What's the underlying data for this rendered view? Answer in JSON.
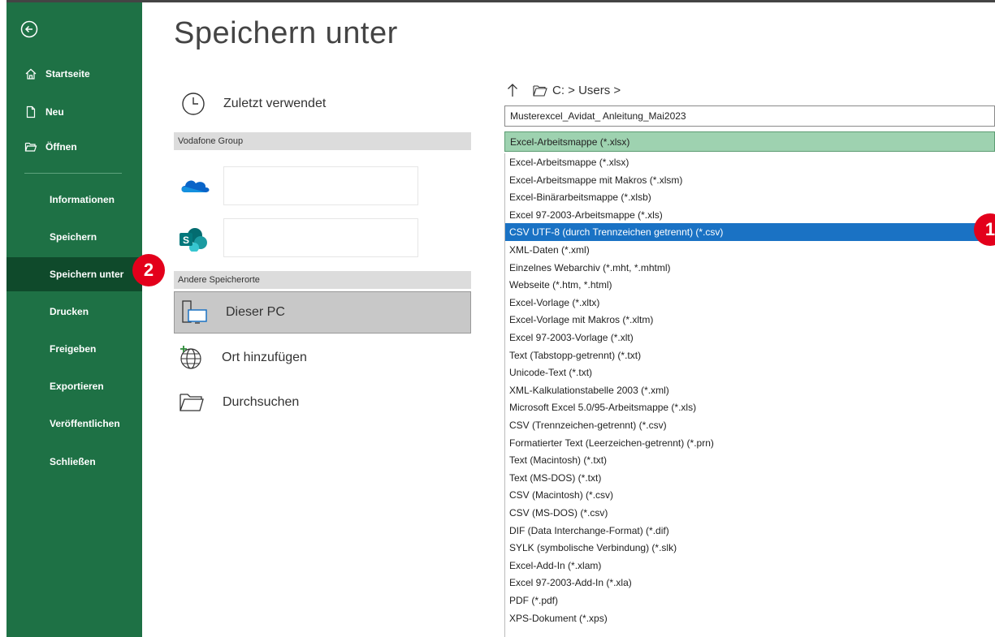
{
  "title": "Speichern unter",
  "sidebar": {
    "top_items": [
      {
        "label": "Startseite",
        "icon": "home-icon"
      },
      {
        "label": "Neu",
        "icon": "new-document-icon"
      },
      {
        "label": "Öffnen",
        "icon": "open-folder-icon"
      }
    ],
    "items": [
      {
        "label": "Informationen"
      },
      {
        "label": "Speichern"
      },
      {
        "label": "Speichern unter",
        "active": true
      },
      {
        "label": "Drucken"
      },
      {
        "label": "Freigeben"
      },
      {
        "label": "Exportieren"
      },
      {
        "label": "Veröffentlichen"
      },
      {
        "label": "Schließen"
      }
    ]
  },
  "badges": {
    "save_as": "2",
    "csv": "1"
  },
  "locations": {
    "recent": "Zuletzt verwendet",
    "group_header": "Vodafone Group",
    "other_header": "Andere Speicherorte",
    "this_pc": "Dieser PC",
    "add_place": "Ort hinzufügen",
    "browse": "Durchsuchen"
  },
  "path": "C: > Users >",
  "filename": "Musterexcel_Avidat_ Anleitung_Mai2023",
  "selected_type": "Excel-Arbeitsmappe (*.xlsx)",
  "file_types": [
    "Excel-Arbeitsmappe (*.xlsx)",
    "Excel-Arbeitsmappe mit Makros (*.xlsm)",
    "Excel-Binärarbeitsmappe (*.xlsb)",
    "Excel 97-2003-Arbeitsmappe (*.xls)",
    "CSV UTF-8 (durch Trennzeichen getrennt) (*.csv)",
    "XML-Daten (*.xml)",
    "Einzelnes Webarchiv (*.mht, *.mhtml)",
    "Webseite (*.htm, *.html)",
    "Excel-Vorlage (*.xltx)",
    "Excel-Vorlage mit Makros (*.xltm)",
    "Excel 97-2003-Vorlage (*.xlt)",
    "Text (Tabstopp-getrennt) (*.txt)",
    "Unicode-Text (*.txt)",
    "XML-Kalkulationstabelle 2003 (*.xml)",
    "Microsoft Excel 5.0/95-Arbeitsmappe (*.xls)",
    "CSV (Trennzeichen-getrennt) (*.csv)",
    "Formatierter Text (Leerzeichen-getrennt) (*.prn)",
    "Text (Macintosh) (*.txt)",
    "Text (MS-DOS) (*.txt)",
    "CSV (Macintosh) (*.csv)",
    "CSV (MS-DOS) (*.csv)",
    "DIF (Data Interchange-Format) (*.dif)",
    "SYLK (symbolische Verbindung) (*.slk)",
    "Excel-Add-In (*.xlam)",
    "Excel 97-2003-Add-In (*.xla)",
    "PDF (*.pdf)",
    "XPS-Dokument (*.xps)"
  ],
  "highlighted_type_index": 4,
  "colors": {
    "sidebar": "#1e7145",
    "sidebar_active": "#0f4a2b",
    "badge": "#e3001b",
    "selection": "#1a72c4",
    "dropdown": "#9ed2b0"
  }
}
